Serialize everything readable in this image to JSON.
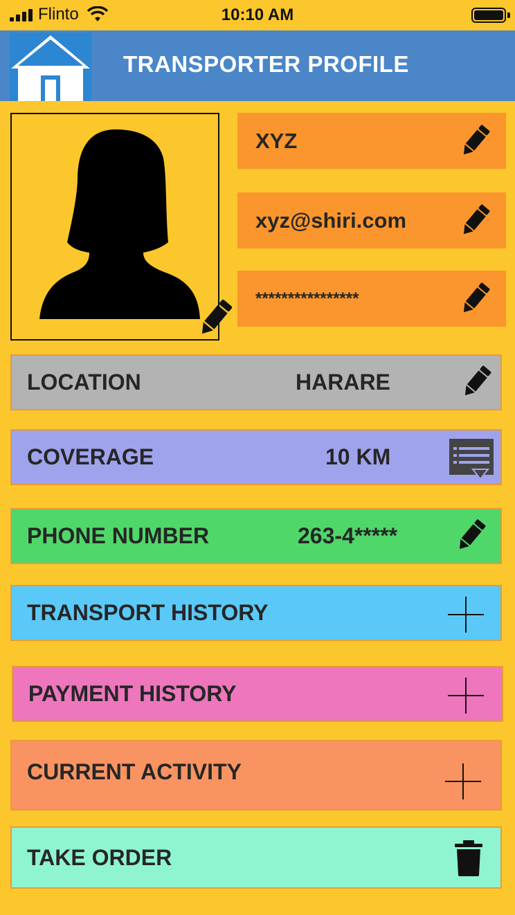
{
  "status_bar": {
    "carrier": "Flinto",
    "time": "10:10 AM"
  },
  "header": {
    "title": "TRANSPORTER PROFILE",
    "home_icon": "home-icon"
  },
  "profile": {
    "avatar_icon": "person-silhouette-icon",
    "name": "XYZ",
    "email": "xyz@shiri.com",
    "password": "****************"
  },
  "rows": {
    "location": {
      "label": "LOCATION",
      "value": "HARARE",
      "color": "#b3b3b3"
    },
    "coverage": {
      "label": "COVERAGE",
      "value": "10 KM",
      "color": "#9fa3ec"
    },
    "phone": {
      "label": "PHONE NUMBER",
      "value": "263-4*****",
      "color": "#50d76a"
    },
    "transport_history": {
      "label": "TRANSPORT HISTORY",
      "color": "#5bc9f7"
    },
    "payment_history": {
      "label": "PAYMENT HISTORY",
      "color": "#ed76bd"
    },
    "current_activity": {
      "label": "CURRENT ACTIVITY",
      "color": "#f99462"
    },
    "take_order": {
      "label": "TAKE ORDER",
      "color": "#8ef5d0"
    }
  },
  "colors": {
    "background": "#fcc72c",
    "header": "#4a86c8",
    "field": "#fa962d"
  }
}
